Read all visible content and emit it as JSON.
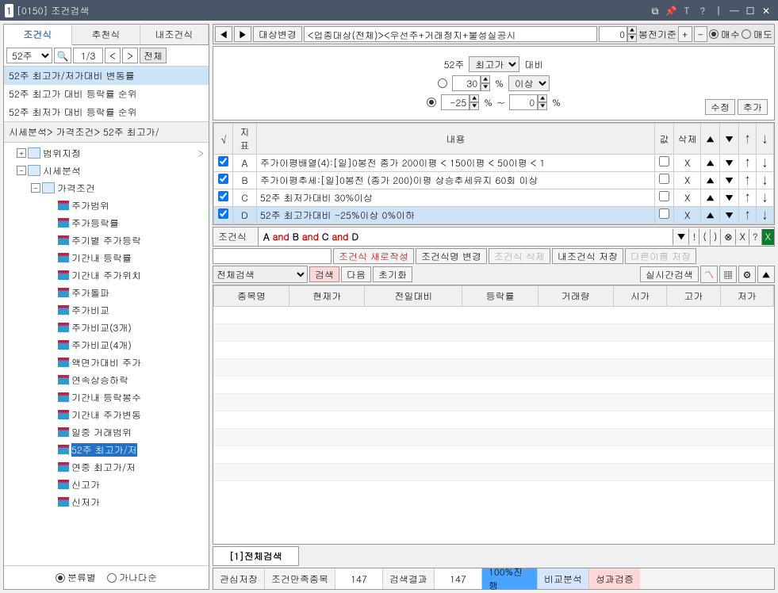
{
  "title": {
    "num": "1",
    "code": "[0150]",
    "name": "조건검색"
  },
  "left": {
    "tabs": [
      "조건식",
      "추천식",
      "내조건식"
    ],
    "search_sel": "52주",
    "page": "1/3",
    "all": "전체",
    "list": [
      "52주 최고가/저가대비 변동률",
      "52주 최고가 대비 등락률 순위",
      "52주 최저가 대비 등락률 순위"
    ],
    "breadcrumb": "시세분석> 가격조건> 52주 최고가/",
    "tree": {
      "n0": "범위지정",
      "n1": "시세분석",
      "n2": "가격조건",
      "leaves": [
        "주가범위",
        "주가등락률",
        "주기별 주가등락",
        "기간내 등락률",
        "기간내 주가위치",
        "주가돌파",
        "주가비교",
        "주가비교(3개)",
        "주가비교(4개)",
        "액면가대비 주가",
        "연속상승하락",
        "기간내 등락봉수",
        "기간내 주가변동",
        "일중 거래범위",
        "52주 최고가/저",
        "연중 최고가/저",
        "신고가",
        "신저가"
      ]
    },
    "sort": {
      "a": "분류별",
      "b": "가나다순"
    }
  },
  "rtop": {
    "target_btn": "대상변경",
    "target_txt": "<업종대상(전체)><우선주+거래정지+불성실공시",
    "bong_val": "0",
    "bong_label": "봉전기준",
    "plus": "+",
    "minus": "-",
    "buy": "매수",
    "sell": "매도"
  },
  "config": {
    "week": "52주",
    "price": "최고가",
    "vs": "대비",
    "v1": "30",
    "pct": "%",
    "cond": "이상",
    "v2": "-25",
    "tilde": "~",
    "v3": "0",
    "edit": "수정",
    "add": "추가"
  },
  "condtbl": {
    "hdr": {
      "c0": "√",
      "c1": "지표",
      "c2": "내용",
      "c3": "값",
      "c4": "삭제",
      "c5": "▲",
      "c6": "▼",
      "c7": "↑",
      "c8": "↓"
    },
    "rows": [
      {
        "id": "A",
        "desc": "주가이평배열(4):[일]0봉전 종가 200이평 < 150이평 < 50이평 < 1"
      },
      {
        "id": "B",
        "desc": "주가이평추세:[일]0봉전 (종가 200)이평 상승추세유지 60회 이상"
      },
      {
        "id": "C",
        "desc": "52주 최저가대비 30%이상"
      },
      {
        "id": "D",
        "desc": "52주 최고가대비 -25%이상 0%이하"
      }
    ],
    "x": "X"
  },
  "formula": {
    "label": "조건식",
    "parts": [
      "A",
      "B",
      "C",
      "D"
    ],
    "and": "and",
    "btns": {
      "dn": "▼",
      "ex": "!",
      "lp": "(",
      "rp": ")",
      "cx": "⊗",
      "xx": "X",
      "q": "?"
    }
  },
  "actions": {
    "new": "조건식 새로작성",
    "rename": "조건식명 변경",
    "del": "조건식 삭제",
    "save": "내조건식 저장",
    "saveas": "다른이름 저장"
  },
  "searchctl": {
    "scope": "전체검색",
    "search": "검색",
    "next": "다음",
    "reset": "초기화",
    "rt": "실시간검색"
  },
  "results": {
    "cols": [
      "종목명",
      "현재가",
      "전일대비",
      "등락률",
      "거래량",
      "시가",
      "고가",
      "저가"
    ]
  },
  "status_tab": "[1]전체검색",
  "footer": {
    "watch": "관심저장",
    "l1": "조건만족종목",
    "v1": "147",
    "l2": "검색결과",
    "v2": "147",
    "prog": "100%진행",
    "cmp": "비교분석",
    "perf": "성과검증"
  }
}
